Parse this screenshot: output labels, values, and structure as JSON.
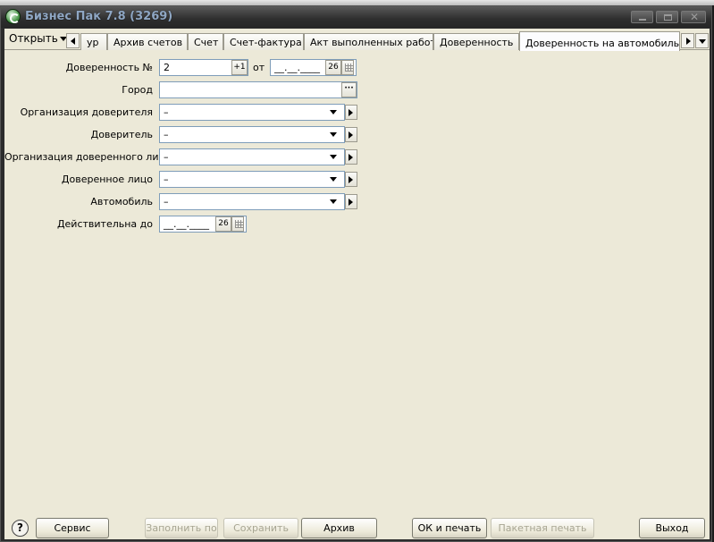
{
  "window": {
    "title": "Бизнес Пак 7.8 (3269)"
  },
  "toolbar": {
    "open_label": "Открыть"
  },
  "tabs": [
    {
      "label": "ур"
    },
    {
      "label": "Архив счетов"
    },
    {
      "label": "Счет"
    },
    {
      "label": "Счет-фактура"
    },
    {
      "label": "Акт выполненных работ"
    },
    {
      "label": "Доверенность"
    },
    {
      "label": "Доверенность на автомобиль",
      "active": true,
      "close": "✕"
    }
  ],
  "form": {
    "number_label": "Доверенность №",
    "number_value": "2",
    "increment_label": "+1",
    "from_label": "от",
    "date_value": "__.__.____",
    "calendar_label": "26",
    "city_label": "Город",
    "city_value": "",
    "city_btn": "···",
    "org_principal_label": "Организация доверителя",
    "org_principal_value": "–",
    "principal_label": "Доверитель",
    "principal_value": "–",
    "org_agent_label": "Организация доверенного лица",
    "org_agent_value": "–",
    "agent_label": "Доверенное лицо",
    "agent_value": "–",
    "car_label": "Автомобиль",
    "car_value": "–",
    "valid_until_label": "Действительна до",
    "valid_until_value": "__.__.____",
    "valid_calendar_label": "26"
  },
  "footer": {
    "help": "?",
    "service": "Сервис",
    "fill_from": "Заполнить по",
    "save": "Сохранить",
    "archive": "Архив",
    "ok_print": "ОК и печать",
    "batch_print": "Пакетная печать",
    "exit": "Выход"
  }
}
